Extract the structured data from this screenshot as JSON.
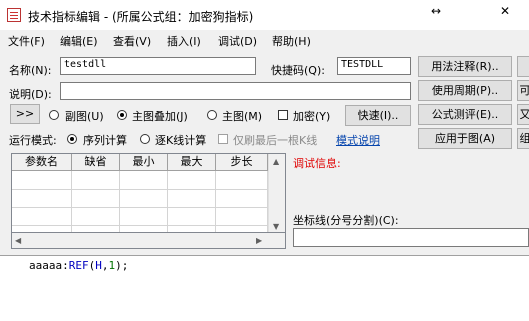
{
  "window": {
    "title": "技术指标编辑 - (所属公式组：加密狗指标)",
    "resize_glyph": "↔",
    "close_glyph": "✕"
  },
  "menu": [
    "文件(F)",
    "编辑(E)",
    "查看(V)",
    "插入(I)",
    "调试(D)",
    "帮助(H)"
  ],
  "form": {
    "name_label": "名称(N):",
    "name_value": "testdll",
    "shortcut_label": "快捷码(Q):",
    "shortcut_value": "TESTDLL",
    "desc_label": "说明(D):",
    "desc_value": ""
  },
  "buttons": {
    "usage_notes": "用法注释(R)..",
    "usage_cycle": "使用周期(P)..",
    "formula_test": "公式测评(E)..",
    "apply_chart": "应用于图(A)",
    "quick": "快速(I)..",
    "expand": ">>",
    "right_col_2": "可",
    "right_col_3": "又",
    "right_col_4": "组"
  },
  "display_mode": {
    "options": [
      "副图(U)",
      "主图叠加(J)",
      "主图(M)"
    ],
    "selected": "主图叠加(J)",
    "encrypt_label": "加密(Y)",
    "encrypt_checked": false
  },
  "run_mode": {
    "label": "运行模式:",
    "options": [
      "序列计算",
      "逐K线计算"
    ],
    "selected": "序列计算",
    "refresh_last_label": "仅刷最后一根K线",
    "refresh_last_enabled": false,
    "model_link": "模式说明"
  },
  "param_table": {
    "headers": [
      "参数名",
      "缺省",
      "最小",
      "最大",
      "步长"
    ],
    "rows": []
  },
  "debug": {
    "label": "调试信息:",
    "color": "#e00000"
  },
  "coord": {
    "label": "坐标线(分号分割)(C):",
    "value": ""
  },
  "editor": {
    "var": "aaaaa",
    "sep": ":",
    "func": "REF",
    "lparen": "(",
    "arg1": "H",
    "comma": ",",
    "arg2": "1",
    "rparen": ")",
    "end": ";"
  }
}
